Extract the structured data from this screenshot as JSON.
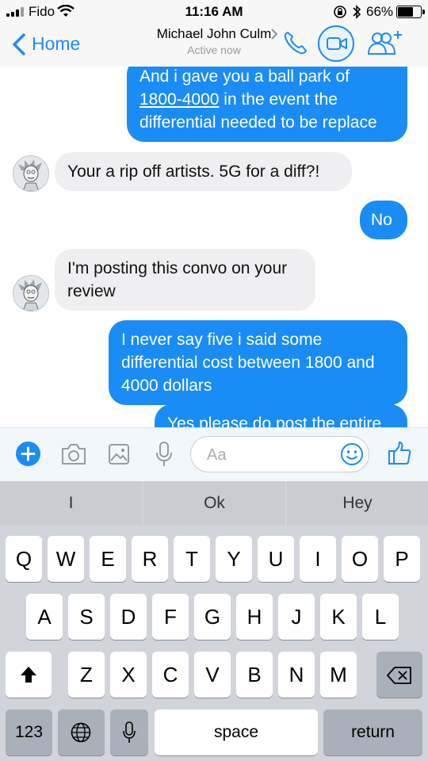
{
  "status_bar": {
    "carrier": "Fido",
    "time": "11:16 AM",
    "battery": "66%"
  },
  "nav": {
    "back_label": "Home",
    "contact_name": "Michael John Culm",
    "presence": "Active now"
  },
  "messages": [
    {
      "side": "out",
      "pre": "And i gave you a ball park of",
      "link": "1800-4000",
      "post": " in the event the differential needed to be replace"
    },
    {
      "side": "in",
      "text": "Your a rip off artists. 5G for a diff?!"
    },
    {
      "side": "out",
      "text": "No"
    },
    {
      "side": "in",
      "text": "I'm posting this convo on your review"
    },
    {
      "side": "out",
      "text": "I never say five i said some differential cost between 1800 and 4000 dollars"
    },
    {
      "side": "out",
      "text": "Yes please do post the entire"
    }
  ],
  "composer": {
    "placeholder": "Aa"
  },
  "keyboard": {
    "suggestions": [
      "I",
      "Ok",
      "Hey"
    ],
    "row1": [
      "Q",
      "W",
      "E",
      "R",
      "T",
      "Y",
      "U",
      "I",
      "O",
      "P"
    ],
    "row2": [
      "A",
      "S",
      "D",
      "F",
      "G",
      "H",
      "J",
      "K",
      "L"
    ],
    "row3": [
      "Z",
      "X",
      "C",
      "V",
      "B",
      "N",
      "M"
    ],
    "numbers_label": "123",
    "space_label": "space",
    "return_label": "return"
  },
  "colors": {
    "accent": "#1a8cf5",
    "incoming_bubble": "#efeff1"
  },
  "icons": [
    "wifi-icon",
    "bluetooth-icon",
    "lock-rotation-icon",
    "battery-icon",
    "back-chevron-icon",
    "phone-icon",
    "video-icon",
    "add-people-icon",
    "plus-icon",
    "camera-icon",
    "image-icon",
    "mic-icon",
    "emoji-icon",
    "thumbs-up-icon",
    "shift-icon",
    "delete-icon",
    "globe-icon"
  ]
}
